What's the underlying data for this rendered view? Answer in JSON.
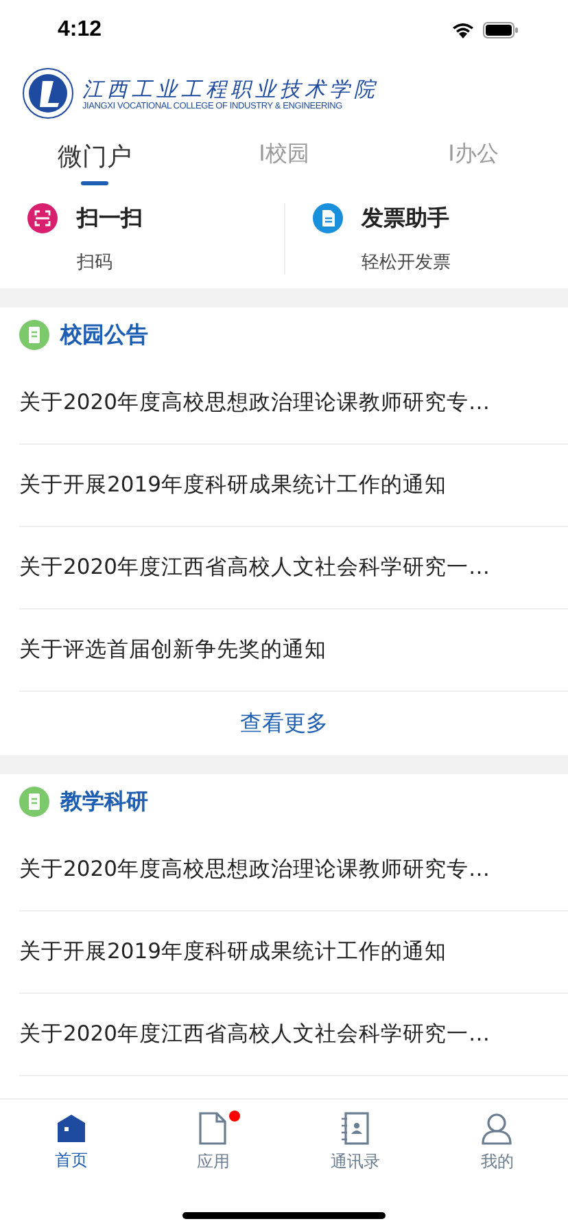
{
  "status_bar": {
    "time": "4:12"
  },
  "header": {
    "logo_title": "江西工业工程职业技术学院",
    "logo_subtitle": "JIANGXI VOCATIONAL COLLEGE OF INDUSTRY & ENGINEERING"
  },
  "tabs": [
    {
      "label": "微门户",
      "selected": true
    },
    {
      "label": "I校园",
      "selected": false
    },
    {
      "label": "I办公",
      "selected": false
    }
  ],
  "quick_actions": [
    {
      "kind": "scan",
      "title": "扫一扫",
      "subtitle": "扫码",
      "color": "#d9206e"
    },
    {
      "kind": "invoice",
      "title": "发票助手",
      "subtitle": "轻松开发票",
      "color": "#1a8fdc"
    }
  ],
  "sections": [
    {
      "title": "校园公告",
      "items": [
        "关于2020年度高校思想政治理论课教师研究专…",
        "关于开展2019年度科研成果统计工作的通知",
        "关于2020年度江西省高校人文社会科学研究一…",
        "关于评选首届创新争先奖的通知"
      ],
      "more": "查看更多"
    },
    {
      "title": "教学科研",
      "items": [
        "关于2020年度高校思想政治理论课教师研究专…",
        "关于开展2019年度科研成果统计工作的通知",
        "关于2020年度江西省高校人文社会科学研究一…"
      ]
    }
  ],
  "tab_bar": [
    {
      "kind": "home",
      "label": "首页",
      "selected": true,
      "badge": false
    },
    {
      "kind": "apps",
      "label": "应用",
      "selected": false,
      "badge": true
    },
    {
      "kind": "contacts",
      "label": "通讯录",
      "selected": false,
      "badge": false
    },
    {
      "kind": "profile",
      "label": "我的",
      "selected": false,
      "badge": false
    }
  ]
}
